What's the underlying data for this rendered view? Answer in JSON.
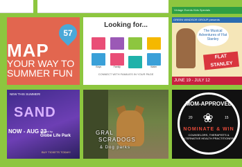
{
  "top": {
    "banner_text": "Vintage  Events  Kids  Specials"
  },
  "map_tile": {
    "pin_number": "57",
    "line1": "MAP",
    "line2": "YOUR WAY TO",
    "line3": "SUMMER FUN"
  },
  "looking_tile": {
    "title": "Looking for...",
    "categories": [
      "",
      "",
      "",
      "",
      "Boys",
      "Family",
      "",
      "Water"
    ],
    "footer": "CONNECT WITH\nFAMILIES IN YOUR PAGE"
  },
  "musical_tile": {
    "header": "GREEN WINDSOR GROUP presents",
    "cloud_text": "The Musical Adventures of Flat Stanley",
    "flat_label": "FLAT STANLEY",
    "dates": "JUNE 19 - JULY 12"
  },
  "sand_tile": {
    "tag": "NEW THIS SUMMER!",
    "title": "SAND",
    "date": "NOW - AUG 23",
    "presented_by": "Hosted by",
    "venue": "Globe Life Park",
    "tickets": "BUY TICKETS TODAY!"
  },
  "dog_tile": {
    "line1": "GRAL",
    "line2": "SCRADOGS",
    "line3": "& Dog parks"
  },
  "mom_tile": {
    "title": "MOM-APPROVED",
    "year_left": "20",
    "year_right": "15",
    "nominate": "NOMINATE & WIN",
    "small": "COUNSELORS, THERAPISTS & ALTERNATIVE HEALTH PRACTITIONERS"
  }
}
